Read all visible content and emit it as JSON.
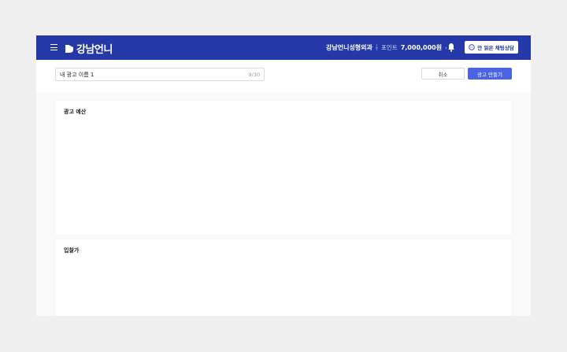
{
  "header": {
    "brand": "강남언니",
    "hospital_name": "강남언니성형외과",
    "points_label": "포인트",
    "points_value": "7,000,000원",
    "chat_button": "안 읽은 채팅상담",
    "accent_color": "#2438a8"
  },
  "toolbar": {
    "ad_name_value": "내 광고 이름 1",
    "ad_name_count": "9/30",
    "cancel_label": "취소",
    "create_label": "광고 만들기",
    "create_color": "#4a64e4"
  },
  "sections": [
    {
      "title": "광고 예산"
    },
    {
      "title": "입찰가"
    }
  ],
  "icons": [
    "menu-icon",
    "logo-icon",
    "chevron-down-icon",
    "chevron-right-icon",
    "bell-icon",
    "chat-icon"
  ]
}
